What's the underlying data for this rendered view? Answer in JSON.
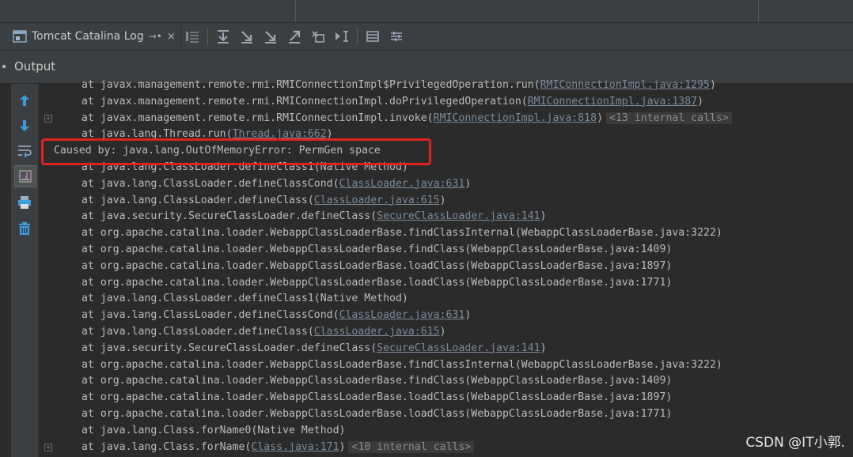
{
  "tab": {
    "label": "Tomcat Catalina Log",
    "pin": "→•",
    "close": "×"
  },
  "output": {
    "label": "Output"
  },
  "toolbar": {
    "icons": [
      "soft-wraps-icon",
      "scroll-to-end-icon",
      "step-into-icon",
      "step-over-icon",
      "step-out-icon",
      "drop-frame-icon",
      "run-to-cursor-icon",
      "evaluate-icon",
      "table-icon",
      "settings-icon"
    ]
  },
  "leftbar": {
    "icons": [
      "up-arrow-icon",
      "down-arrow-icon",
      "soft-wrap-icon",
      "scroll-end-icon",
      "print-icon",
      "trash-icon"
    ]
  },
  "log_lines": [
    {
      "indent": true,
      "text": "at javax.management.remote.rmi.RMIConnectionImpl$PrivilegedOperation.run(",
      "link": "RMIConnectionImpl.java:1295",
      "tail": ")",
      "fold": ""
    },
    {
      "indent": true,
      "text": "at javax.management.remote.rmi.RMIConnectionImpl.doPrivilegedOperation(",
      "link": "RMIConnectionImpl.java:1387",
      "tail": ")",
      "fold": ""
    },
    {
      "indent": true,
      "text": "at javax.management.remote.rmi.RMIConnectionImpl.invoke(",
      "link": "RMIConnectionImpl.java:818",
      "tail": ")",
      "fold": "<13 internal calls>"
    },
    {
      "indent": true,
      "text": "at java.lang.Thread.run(",
      "link": "Thread.java:662",
      "tail": ")",
      "fold": ""
    },
    {
      "indent": false,
      "text": "Caused by: java.lang.OutOfMemoryError: PermGen space",
      "link": "",
      "tail": "",
      "fold": ""
    },
    {
      "indent": true,
      "text": "at java.lang.ClassLoader.defineClass1(Native Method)",
      "link": "",
      "tail": "",
      "fold": ""
    },
    {
      "indent": true,
      "text": "at java.lang.ClassLoader.defineClassCond(",
      "link": "ClassLoader.java:631",
      "tail": ")",
      "fold": ""
    },
    {
      "indent": true,
      "text": "at java.lang.ClassLoader.defineClass(",
      "link": "ClassLoader.java:615",
      "tail": ")",
      "fold": ""
    },
    {
      "indent": true,
      "text": "at java.security.SecureClassLoader.defineClass(",
      "link": "SecureClassLoader.java:141",
      "tail": ")",
      "fold": ""
    },
    {
      "indent": true,
      "text": "at org.apache.catalina.loader.WebappClassLoaderBase.findClassInternal(WebappClassLoaderBase.java:3222)",
      "link": "",
      "tail": "",
      "fold": ""
    },
    {
      "indent": true,
      "text": "at org.apache.catalina.loader.WebappClassLoaderBase.findClass(WebappClassLoaderBase.java:1409)",
      "link": "",
      "tail": "",
      "fold": ""
    },
    {
      "indent": true,
      "text": "at org.apache.catalina.loader.WebappClassLoaderBase.loadClass(WebappClassLoaderBase.java:1897)",
      "link": "",
      "tail": "",
      "fold": ""
    },
    {
      "indent": true,
      "text": "at org.apache.catalina.loader.WebappClassLoaderBase.loadClass(WebappClassLoaderBase.java:1771)",
      "link": "",
      "tail": "",
      "fold": ""
    },
    {
      "indent": true,
      "text": "at java.lang.ClassLoader.defineClass1(Native Method)",
      "link": "",
      "tail": "",
      "fold": ""
    },
    {
      "indent": true,
      "text": "at java.lang.ClassLoader.defineClassCond(",
      "link": "ClassLoader.java:631",
      "tail": ")",
      "fold": ""
    },
    {
      "indent": true,
      "text": "at java.lang.ClassLoader.defineClass(",
      "link": "ClassLoader.java:615",
      "tail": ")",
      "fold": ""
    },
    {
      "indent": true,
      "text": "at java.security.SecureClassLoader.defineClass(",
      "link": "SecureClassLoader.java:141",
      "tail": ")",
      "fold": ""
    },
    {
      "indent": true,
      "text": "at org.apache.catalina.loader.WebappClassLoaderBase.findClassInternal(WebappClassLoaderBase.java:3222)",
      "link": "",
      "tail": "",
      "fold": ""
    },
    {
      "indent": true,
      "text": "at org.apache.catalina.loader.WebappClassLoaderBase.findClass(WebappClassLoaderBase.java:1409)",
      "link": "",
      "tail": "",
      "fold": ""
    },
    {
      "indent": true,
      "text": "at org.apache.catalina.loader.WebappClassLoaderBase.loadClass(WebappClassLoaderBase.java:1897)",
      "link": "",
      "tail": "",
      "fold": ""
    },
    {
      "indent": true,
      "text": "at org.apache.catalina.loader.WebappClassLoaderBase.loadClass(WebappClassLoaderBase.java:1771)",
      "link": "",
      "tail": "",
      "fold": ""
    },
    {
      "indent": true,
      "text": "at java.lang.Class.forName0(Native Method)",
      "link": "",
      "tail": "",
      "fold": ""
    },
    {
      "indent": true,
      "text": "at java.lang.Class.forName(",
      "link": "Class.java:171",
      "tail": ")",
      "fold": "<10 internal calls>"
    }
  ],
  "watermark": "CSDN @IT小郭.",
  "colors": {
    "highlight_border": "#e0221f",
    "link": "#7a8a99",
    "text": "#bbbbbb",
    "background": "#2b2b2b"
  }
}
